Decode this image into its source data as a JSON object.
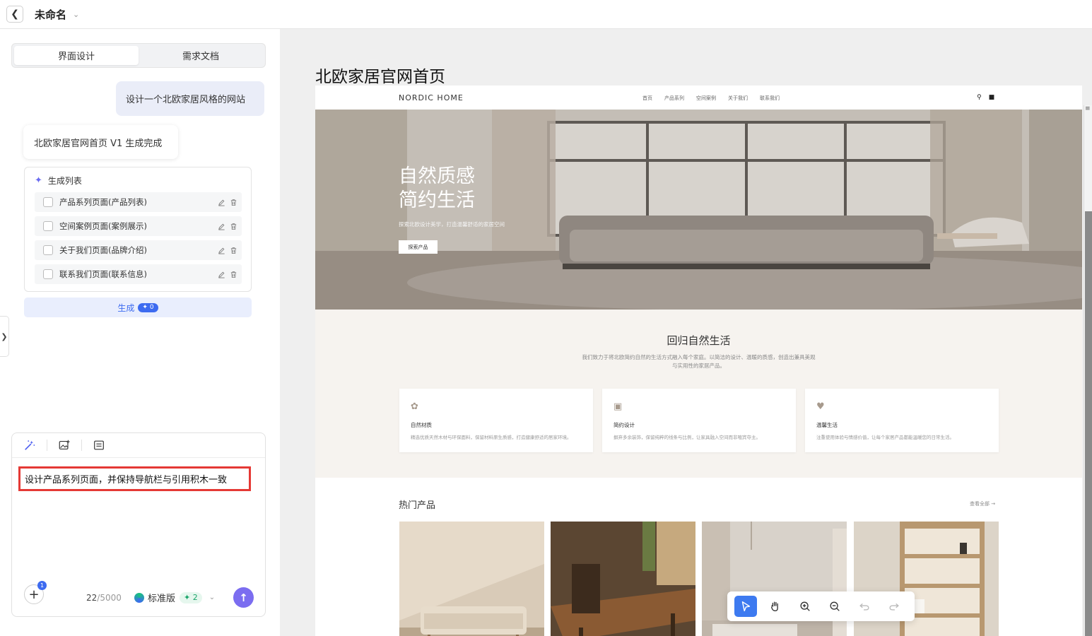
{
  "header": {
    "title": "未命名"
  },
  "left_panel": {
    "tabs": [
      {
        "label": "界面设计",
        "active": true
      },
      {
        "label": "需求文档",
        "active": false
      }
    ],
    "user_message": "设计一个北欧家居风格的网站",
    "ai_message": "北欧家居官网首页 V1 生成完成",
    "generation_list": {
      "title": "生成列表",
      "items": [
        {
          "label": "产品系列页面(产品列表)"
        },
        {
          "label": "空间案例页面(案例展示)"
        },
        {
          "label": "关于我们页面(品牌介绍)"
        },
        {
          "label": "联系我们页面(联系信息)"
        }
      ]
    },
    "generate_button": {
      "label": "生成",
      "credit": "0"
    },
    "composer": {
      "text": "设计产品系列页面，并保持导航栏与引用积木一致",
      "attachment_count": "1",
      "char_count": "22",
      "char_max": "/5000",
      "model": "标准版",
      "model_credit": "2"
    }
  },
  "canvas": {
    "frame_title": "北欧家居官网首页",
    "site": {
      "brand": "NORDIC HOME",
      "nav": [
        "首页",
        "产品系列",
        "空间案例",
        "关于我们",
        "联系我们"
      ],
      "hero": {
        "line1": "自然质感",
        "line2": "简约生活",
        "subtitle": "探索北欧设计美学，打造温馨舒适的家居空间",
        "cta": "探索产品"
      },
      "about": {
        "title": "回归自然生活",
        "desc": "我们致力于将北欧简约自然的生活方式融入每个家庭。以简洁的设计、温暖的质感，创造出兼具美观与实用性的家居产品。",
        "features": [
          {
            "icon": "leaf-icon",
            "title": "自然材质",
            "desc": "精选优质天然木材与环保面料，保留材料原生质感，打造健康舒适的居家环境。"
          },
          {
            "icon": "cube-icon",
            "title": "简约设计",
            "desc": "摒弃多余装饰，保留纯粹的线条与比例，让家具融入空间而非喧宾夺主。"
          },
          {
            "icon": "heart-icon",
            "title": "温馨生活",
            "desc": "注重使用体验与情感价值，让每个家居产品都能温暖您的日常生活。"
          }
        ]
      },
      "products": {
        "title": "热门产品",
        "more": "查看全部 →"
      }
    }
  },
  "colors": {
    "accent": "#3d6bf0",
    "send": "#7b6df0",
    "highlight": "#e53935"
  }
}
